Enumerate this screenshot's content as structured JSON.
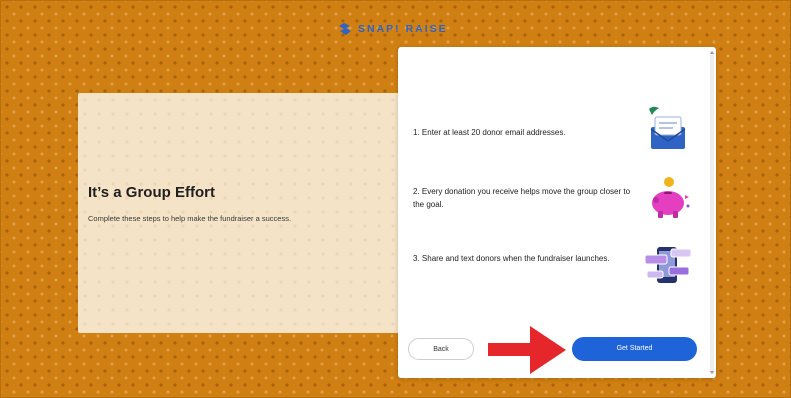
{
  "brand": {
    "name": "SNAP! RAISE"
  },
  "intro": {
    "title": "It’s a Group Effort",
    "subtitle": "Complete these steps to help make the fundraiser a success."
  },
  "steps": [
    {
      "number": "1.",
      "text": "Enter at least 20 donor email addresses.",
      "icon": "envelope-letter-icon"
    },
    {
      "number": "2.",
      "text": "Every donation you receive helps move the group closer to the goal.",
      "icon": "piggy-bank-icon"
    },
    {
      "number": "3.",
      "text": "Share and text donors when the fundraiser launches.",
      "icon": "phone-share-icon"
    }
  ],
  "buttons": {
    "back": "Back",
    "get_started": "Get Started"
  },
  "colors": {
    "background": "#d07f12",
    "panel": "#f4e3c6",
    "brand_blue": "#2f63c4",
    "primary_button": "#1f63d8",
    "annotation_arrow": "#e5262a"
  }
}
